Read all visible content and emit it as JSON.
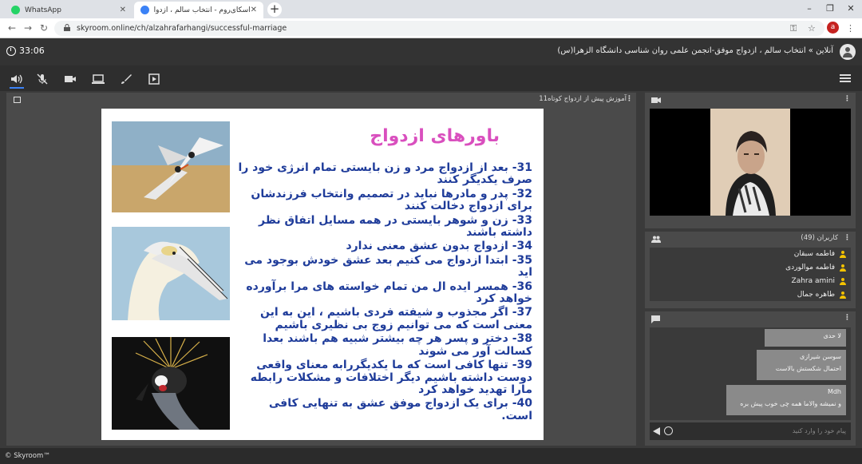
{
  "browser": {
    "tabs": [
      {
        "title": "WhatsApp",
        "active": false
      },
      {
        "title": "اسکای‌روم - انتخاب سالم ، ازدواج در...",
        "active": true
      }
    ],
    "url": "skyroom.online/ch/alzahrafarhangi/successful-marriage",
    "profile_initial": "a"
  },
  "header": {
    "timer": "33:06",
    "title": "آنلاین » انتخاب سالم ، ازدواج موفق-انجمن علمی روان شناسی دانشگاه الزهرا(س)"
  },
  "toolbar": {
    "icons": [
      "speaker-icon",
      "mic-off-icon",
      "camera-icon",
      "screen-share-icon",
      "brush-icon",
      "media-icon"
    ]
  },
  "presentation": {
    "doc_title": "آموزش پیش از ازدواج کوتاه11",
    "slide_title": "باورهای ازدواج",
    "items": [
      "31- بعد از ازدواج مرد و زن بایستی تمام انرژی خود را صرف یکدیگر کنند",
      "32- پدر و مادرها نباید در تصمیم وانتخاب فرزندشان برای ازدواج دخالت کنند",
      "33- زن و شوهر بایستی در همه مسایل اتفاق نظر داشته باشند",
      "34- ازدواج بدون عشق معنی ندارد",
      "35- ابتدا ازدواج می کنیم بعد عشق خودش بوجود می اید",
      "36- همسر ایده ال من تمام خواسته های مرا برآورده خواهد کرد",
      "37- اگر مجذوب و شیفته فردی باشیم ، این به این معنی است که می توانیم زوج بی نظیری باشیم",
      "38- دختر و پسر هر چه بیشتر شبیه هم باشند بعدا کسالت آور می شوند",
      "39- تنها کافی است که ما یکدیگررابه معنای واقعی دوست داشته باشیم دیگر اختلافات و مشکلات رابطه مارا تهدید خواهد کرد",
      "40- برای یک ازدواج موفق عشق به تنهایی کافی است."
    ]
  },
  "users": {
    "title": "کاربران (49)",
    "list": [
      "فاطمه سبقان",
      "فاطمه موالوردی",
      "Zahra amini",
      "طاهره جمال"
    ]
  },
  "chat": {
    "messages": [
      {
        "sender": "لا حدی",
        "text": ""
      },
      {
        "sender": "سوسن شیرازی",
        "text": "احتمال شکستش بالاست"
      },
      {
        "sender": "Mdh",
        "text": "و نمیشه والاما همه چی خوب پیش بره"
      }
    ],
    "input_placeholder": "پیام خود را وارد کنید"
  },
  "footer": {
    "brand": "© Skyroom™"
  }
}
